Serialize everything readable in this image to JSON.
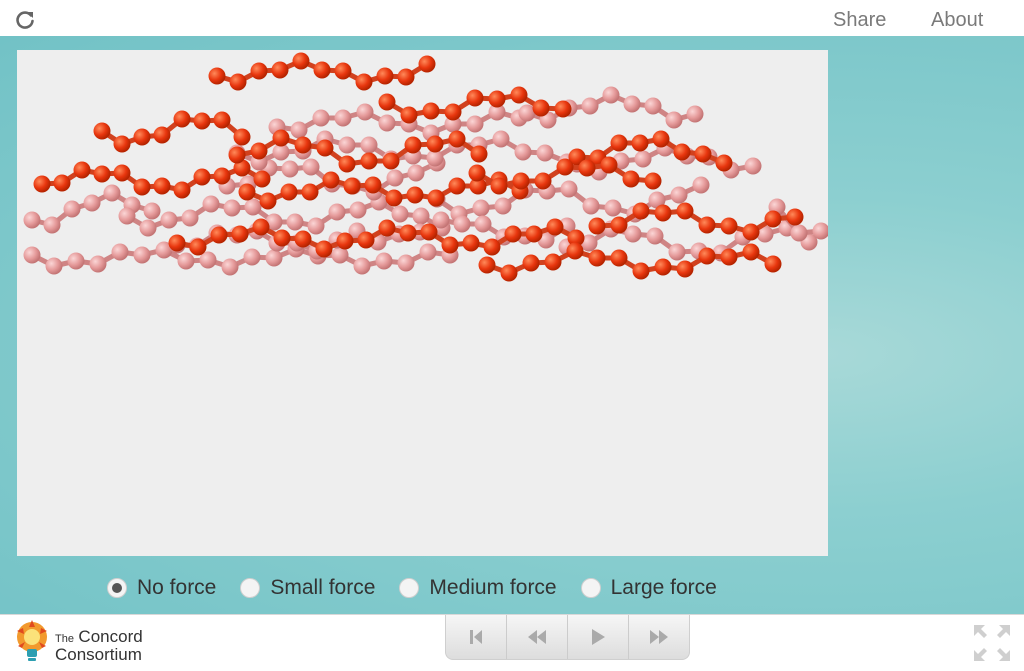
{
  "header": {
    "reload_icon": "reload-icon",
    "share_label": "Share",
    "about_label": "About"
  },
  "simulation": {
    "chain_colors": {
      "dark": "#e8360e",
      "light": "#e59a9a",
      "bond_dark": "#d1411e",
      "bond_light": "#cf8484"
    }
  },
  "forces": {
    "options": [
      {
        "label": "No force",
        "selected": true
      },
      {
        "label": "Small force",
        "selected": false
      },
      {
        "label": "Medium force",
        "selected": false
      },
      {
        "label": "Large force",
        "selected": false
      }
    ]
  },
  "footer": {
    "logo_small": "The",
    "logo_big_1": "Concord",
    "logo_big_2": "Consortium",
    "controls": [
      "reset-icon",
      "step-back-icon",
      "play-icon",
      "step-forward-icon"
    ],
    "fullscreen_icon": "fullscreen-icon"
  }
}
